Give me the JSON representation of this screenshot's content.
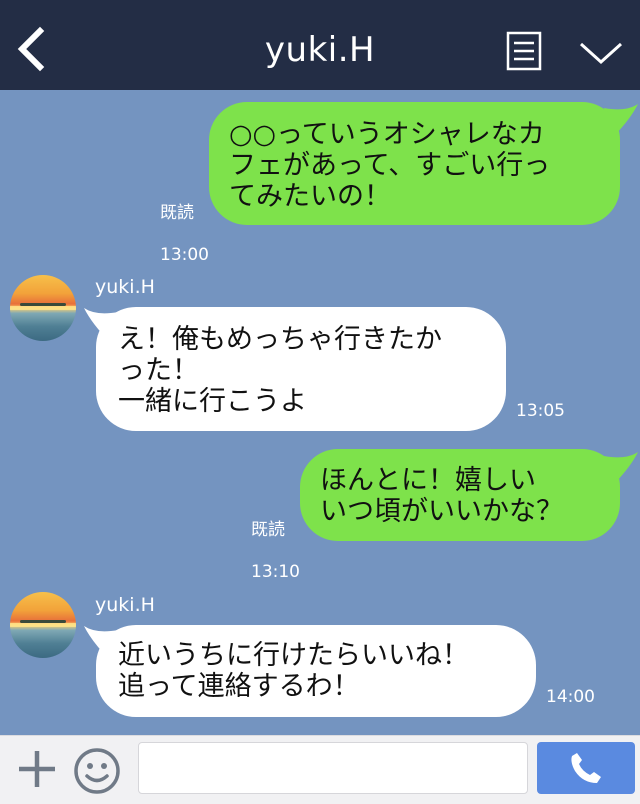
{
  "header": {
    "title": "yuki.H",
    "back_icon": "chevron-left-icon",
    "memo_icon": "note-icon",
    "menu_icon": "chevron-down-icon",
    "background": "#232d45"
  },
  "chat": {
    "background": "#7494c0",
    "messages": [
      {
        "direction": "out",
        "text": "○○っていうオシャレなカ\nフェがあって、すごい行っ\nてみたいの！",
        "read_label": "既読",
        "time": "13:00"
      },
      {
        "direction": "in",
        "sender": "yuki.H",
        "text": "え！俺もめっちゃ行きたか\nった！\n一緒に行こうよ",
        "time": "13:05"
      },
      {
        "direction": "out",
        "text": "ほんとに！嬉しい\nいつ頃がいいかな？",
        "read_label": "既読",
        "time": "13:10"
      },
      {
        "direction": "in",
        "sender": "yuki.H",
        "text": "近いうちに行けたらいいね！\n追って連絡するわ！",
        "time": "14:00"
      }
    ]
  },
  "footer": {
    "plus_icon": "plus-icon",
    "emoji_icon": "smiley-icon",
    "input_value": "",
    "input_placeholder": "",
    "call_icon": "phone-icon",
    "call_color": "#5a8ae0"
  },
  "colors": {
    "outgoing_bubble": "#7ee24b",
    "incoming_bubble": "#ffffff"
  }
}
